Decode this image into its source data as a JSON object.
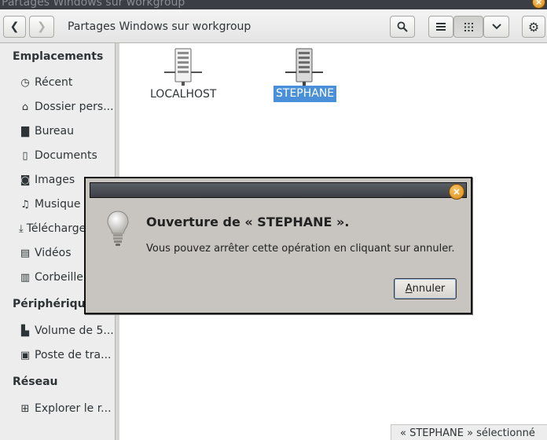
{
  "window": {
    "title": "Partages Windows sur workgroup",
    "close_icon": "close-icon"
  },
  "toolbar": {
    "back_icon": "chevron-left-icon",
    "forward_icon": "chevron-right-icon",
    "location_title": "Partages Windows sur workgroup",
    "search_icon": "search-icon",
    "list_view_icon": "list-view-icon",
    "grid_view_icon": "grid-view-icon",
    "view_menu_icon": "chevron-down-icon",
    "settings_icon": "gear-icon"
  },
  "sidebar": {
    "places_header": "Emplacements",
    "places": [
      {
        "label": "Récent",
        "icon": "clock-icon",
        "glyph": "◷"
      },
      {
        "label": "Dossier pers...",
        "icon": "home-icon",
        "glyph": "⌂"
      },
      {
        "label": "Bureau",
        "icon": "folder-icon",
        "glyph": "▇"
      },
      {
        "label": "Documents",
        "icon": "document-icon",
        "glyph": "▯"
      },
      {
        "label": "Images",
        "icon": "camera-icon",
        "glyph": "◙"
      },
      {
        "label": "Musique",
        "icon": "music-icon",
        "glyph": "♫"
      },
      {
        "label": "Téléchargements",
        "icon": "download-icon",
        "glyph": "⤓"
      },
      {
        "label": "Vidéos",
        "icon": "film-icon",
        "glyph": "▤"
      },
      {
        "label": "Corbeille",
        "icon": "trash-icon",
        "glyph": "▥"
      }
    ],
    "devices_header": "Périphériques",
    "devices": [
      {
        "label": "Volume de 5...",
        "icon": "drive-icon",
        "glyph": "▙"
      },
      {
        "label": "Poste de tra...",
        "icon": "computer-icon",
        "glyph": "▣"
      }
    ],
    "network_header": "Réseau",
    "network": [
      {
        "label": "Explorer le r...",
        "icon": "network-icon",
        "glyph": "⊞"
      }
    ]
  },
  "content": {
    "items": [
      {
        "label": "LOCALHOST",
        "icon": "server-icon",
        "selected": false
      },
      {
        "label": "STEPHANE",
        "icon": "server-icon",
        "selected": true
      }
    ],
    "selection_color": "#4a90d9"
  },
  "statusbar": {
    "text": "« STEPHANE » sélectionné"
  },
  "dialog": {
    "icon": "lightbulb-icon",
    "heading": "Ouverture de « STEPHANE ».",
    "message": "Vous pouvez arrêter cette opération en cliquant sur annuler.",
    "cancel_button": {
      "mnemonic": "A",
      "rest": "nnuler"
    },
    "close_icon": "close-icon"
  }
}
